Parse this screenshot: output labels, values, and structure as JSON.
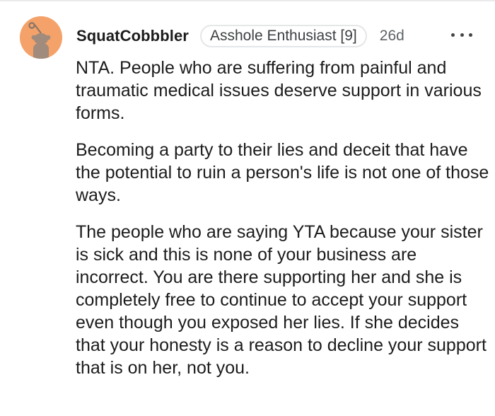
{
  "comment": {
    "author": "SquatCobbbler",
    "flair": "Asshole Enthusiast [9]",
    "age": "26d",
    "paragraphs": [
      "NTA. People who are suffering from painful and traumatic medical issues deserve support in various forms.",
      "Becoming a party to their lies and deceit that have the potential to ruin a person's life is not one of those ways.",
      "The people who are saying YTA because your sister is sick and this is none of your business are incorrect. You are there supporting her and she is completely free to continue to accept your support even though you exposed her lies. If she decides that your honesty is a reason to decline your support that is on her, not you."
    ]
  },
  "icons": {
    "avatar": "snoo-avatar",
    "more": "more-options-icon"
  },
  "colors": {
    "avatar_background": "#f4a26a",
    "text": "#1c1c1c",
    "muted": "#5f6366"
  }
}
